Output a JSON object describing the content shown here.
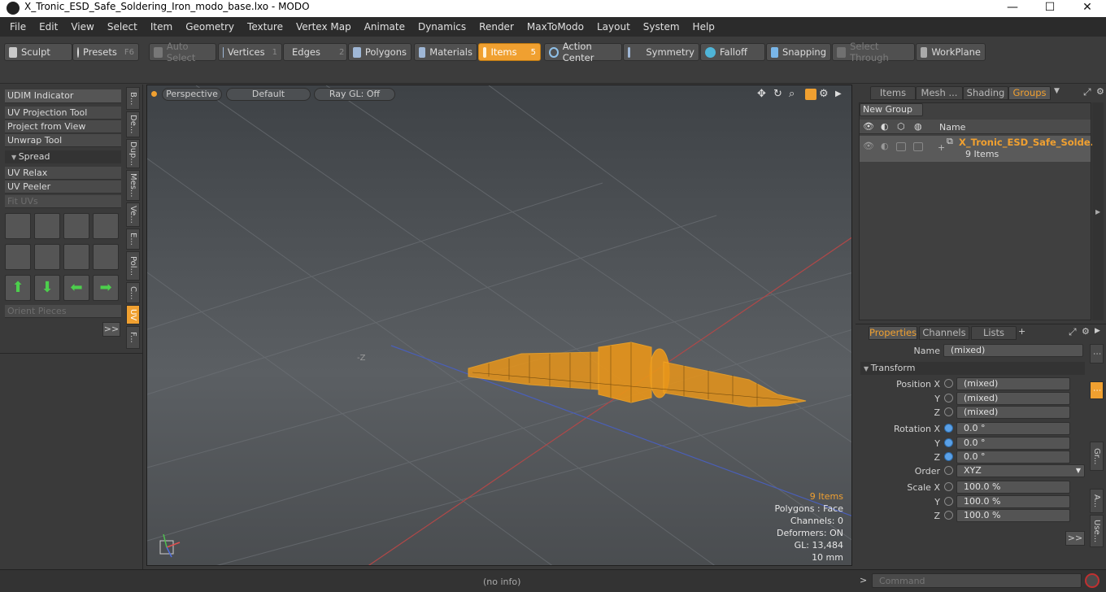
{
  "window": {
    "title": "X_Tronic_ESD_Safe_Soldering_Iron_modo_base.lxo - MODO",
    "minimize": "—",
    "maximize": "☐",
    "close": "✕"
  },
  "menu": [
    "File",
    "Edit",
    "View",
    "Select",
    "Item",
    "Geometry",
    "Texture",
    "Vertex Map",
    "Animate",
    "Dynamics",
    "Render",
    "MaxToModo",
    "Layout",
    "System",
    "Help"
  ],
  "toolbar": {
    "sculpt": "Sculpt",
    "presets": "Presets",
    "presets_key": "F6",
    "auto_select": "Auto Select",
    "vertices": "Vertices",
    "vertices_num": "1",
    "edges": "Edges",
    "edges_num": "2",
    "polygons": "Polygons",
    "materials": "Materials",
    "items": "Items",
    "items_num": "5",
    "action_center": "Action Center",
    "symmetry": "Symmetry",
    "falloff": "Falloff",
    "snapping": "Snapping",
    "select_through": "Select Through",
    "workplane": "WorkPlane"
  },
  "left": {
    "udim": "UDIM Indicator",
    "uv_projection": "UV Projection Tool",
    "project_from_view": "Project from View",
    "unwrap": "Unwrap Tool",
    "spread": "Spread",
    "uv_relax": "UV Relax",
    "uv_peeler": "UV Peeler",
    "fit_uvs": "Fit UVs",
    "orient_pieces": "Orient Pieces",
    "more": ">>",
    "vtabs": [
      "B...",
      "De...",
      "Dup...",
      "Mes...",
      "Ve...",
      "E...",
      "Pol...",
      "C...",
      "UV",
      "F..."
    ]
  },
  "viewport": {
    "perspective": "Perspective",
    "default": "Default",
    "raygl": "Ray GL: Off",
    "axis_label": "-Z",
    "hud": {
      "items": "9 Items",
      "polygons": "Polygons : Face",
      "channels": "Channels: 0",
      "deformers": "Deformers: ON",
      "gl": "GL: 13,484",
      "scale": "10 mm"
    }
  },
  "groups": {
    "tabs": [
      "Items",
      "Mesh ...",
      "Shading",
      "Groups"
    ],
    "new_group": "New Group",
    "col_name": "Name",
    "row_name": "X_Tronic_ESD_Safe_Solde...",
    "row_sub": "9 Items"
  },
  "properties": {
    "tabs": [
      "Properties",
      "Channels",
      "Lists"
    ],
    "add": "+",
    "name_label": "Name",
    "name_value": "(mixed)",
    "transform": "Transform",
    "pos_x_label": "Position X",
    "pos_x": "(mixed)",
    "pos_y_label": "Y",
    "pos_y": "(mixed)",
    "pos_z_label": "Z",
    "pos_z": "(mixed)",
    "rot_x_label": "Rotation X",
    "rot_x": "0.0 °",
    "rot_y_label": "Y",
    "rot_y": "0.0 °",
    "rot_z_label": "Z",
    "rot_z": "0.0 °",
    "order_label": "Order",
    "order": "XYZ",
    "scale_x_label": "Scale X",
    "scale_x": "100.0 %",
    "scale_y_label": "Y",
    "scale_y": "100.0 %",
    "scale_z_label": "Z",
    "scale_z": "100.0 %",
    "more": ">>",
    "side_tabs": [
      "Gr...",
      "A...",
      "Use..."
    ]
  },
  "status": {
    "info": "(no info)",
    "command_placeholder": "Command",
    "prompt": ">"
  },
  "colors": {
    "accent": "#f0a030",
    "wire": "#f5a623"
  }
}
